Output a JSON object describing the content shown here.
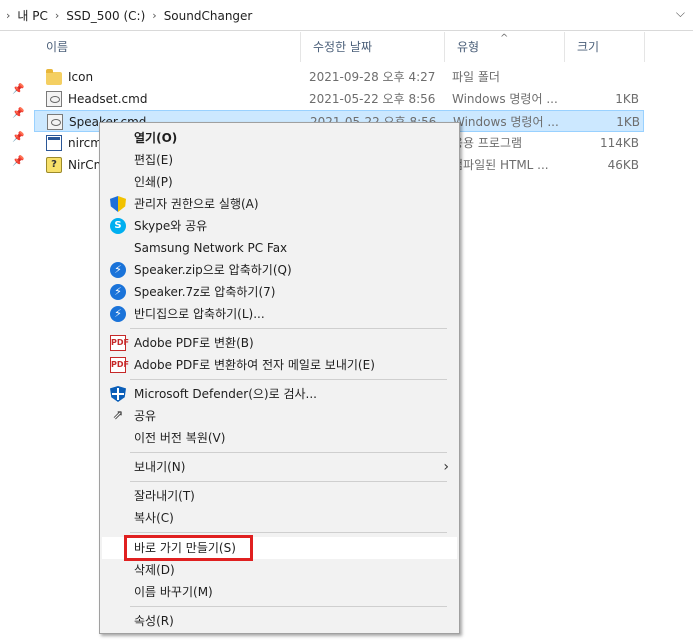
{
  "breadcrumb": [
    "내 PC",
    "SSD_500 (C:)",
    "SoundChanger"
  ],
  "address_dropdown_icon": "chevron-down-icon",
  "columns": {
    "name": "이름",
    "date": "수정한 날짜",
    "type": "유형",
    "size": "크기"
  },
  "files": [
    {
      "name": "Icon",
      "date": "2021-09-28 오후 4:27",
      "type": "파일 폴더",
      "size": "",
      "icon": "folder-icon"
    },
    {
      "name": "Headset.cmd",
      "date": "2021-05-22 오후 8:56",
      "type": "Windows 명령어 ...",
      "size": "1KB",
      "icon": "cmd-file-icon"
    },
    {
      "name": "Speaker.cmd",
      "date": "2021-05-22 오후 8:56",
      "type": "Windows 명령어 ...",
      "size": "1KB",
      "icon": "cmd-file-icon",
      "selected": true
    },
    {
      "name": "nircm",
      "date": "",
      "type": "응용 프로그램",
      "size": "114KB",
      "icon": "exe-file-icon"
    },
    {
      "name": "NirCm",
      "date": "",
      "type": "컴파일된 HTML ...",
      "size": "46KB",
      "icon": "chm-file-icon"
    }
  ],
  "context_menu": {
    "open": "열기(O)",
    "edit": "편집(E)",
    "print": "인쇄(P)",
    "run_as_admin": "관리자 권한으로 실행(A)",
    "skype_share": "Skype와 공유",
    "samsung_fax": "Samsung Network PC Fax",
    "zip": "Speaker.zip으로 압축하기(Q)",
    "sevenz": "Speaker.7z로 압축하기(7)",
    "bandizip": "반디집으로 압축하기(L)...",
    "adobe_pdf": "Adobe PDF로 변환(B)",
    "adobe_pdf_email": "Adobe PDF로 변환하여 전자 메일로 보내기(E)",
    "defender": "Microsoft Defender(으)로 검사...",
    "share": "공유",
    "restore": "이전 버전 복원(V)",
    "send_to": "보내기(N)",
    "cut": "잘라내기(T)",
    "copy": "복사(C)",
    "create_shortcut": "바로 가기 만들기(S)",
    "delete": "삭제(D)",
    "rename": "이름 바꾸기(M)",
    "properties": "속성(R)"
  },
  "highlight_color": "#e02020",
  "selection_color": "#cce8ff"
}
